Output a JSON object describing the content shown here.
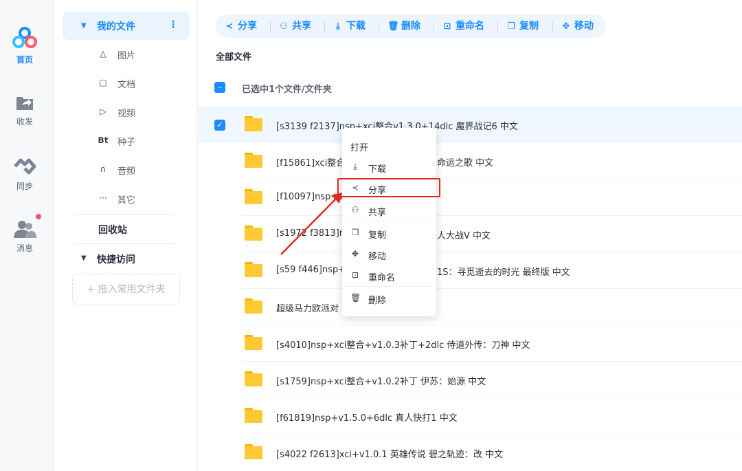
{
  "rail": {
    "items": [
      {
        "label": "首页",
        "icon": "cloud-logo-icon"
      },
      {
        "label": "收发",
        "icon": "folder-share-icon"
      },
      {
        "label": "同步",
        "icon": "sync-icon"
      },
      {
        "label": "消息",
        "icon": "users-icon"
      }
    ],
    "colors": {
      "active": "#1a8cff",
      "badge": "#ff4d6a"
    }
  },
  "nav": {
    "mine": "我的文件",
    "more": "⋮",
    "subs": [
      {
        "icon": "image-icon",
        "glyph": "△",
        "label": "图片"
      },
      {
        "icon": "doc-icon",
        "glyph": "▢",
        "label": "文档"
      },
      {
        "icon": "video-icon",
        "glyph": "▷",
        "label": "视频"
      },
      {
        "icon": "bt-icon",
        "glyph": "Bt",
        "label": "种子"
      },
      {
        "icon": "headphone-icon",
        "glyph": "∩",
        "label": "音频"
      },
      {
        "icon": "more-icon",
        "glyph": "···",
        "label": "其它"
      }
    ],
    "recycle": "回收站",
    "quick": "快捷访问",
    "quick_add": "+ 拖入常用文件夹"
  },
  "toolbar": [
    {
      "glyph": "≺",
      "label": "分享",
      "icon": "share-icon"
    },
    {
      "glyph": "⚇",
      "label": "共享",
      "icon": "co-share-icon"
    },
    {
      "glyph": "⤓",
      "label": "下载",
      "icon": "download-icon"
    },
    {
      "glyph": "🗑",
      "label": "删除",
      "icon": "trash-icon"
    },
    {
      "glyph": "⊡",
      "label": "重命名",
      "icon": "rename-icon"
    },
    {
      "glyph": "❐",
      "label": "复制",
      "icon": "copy-icon"
    },
    {
      "glyph": "✥",
      "label": "移动",
      "icon": "move-icon"
    }
  ],
  "crumb": "全部文件",
  "selection": "已选中1个文件/文件夹",
  "files": [
    "[s3139 f2137]nsp+xci整合v1.3.0+14dlc 魔界战记6 中文",
    "[f15861]xci整合v",
    "[f10097]nsp+v1.",
    "[s1972 f3813]ns",
    "[s59 f446]nsp+v",
    "超级马力欧派对",
    "[s4010]nsp+xci整合+v1.0.3补丁+2dlc 侍道外传：刀神 中文",
    "[s1759]nsp+xci整合+v1.0.2补丁 伊苏：始源 中文",
    "[f61819]nsp+v1.5.0+6dlc 真人快打1 中文",
    "[s4022 f2613]xci+v1.0.1 英雄传说 碧之轨迹：改 中文"
  ],
  "file_tails": [
    "",
    "命运之歌 中文",
    "",
    "人大战V 中文",
    "1S：寻觅逝去的时光 最终版 中文",
    "",
    "",
    "",
    "",
    ""
  ],
  "context_menu": [
    {
      "label": "打开",
      "icon": "",
      "glyph": ""
    },
    {
      "label": "下载",
      "icon": "download-icon",
      "glyph": "⤓"
    },
    {
      "label": "分享",
      "icon": "share-icon",
      "glyph": "≺"
    },
    {
      "label": "共享",
      "icon": "co-share-icon",
      "glyph": "⚇"
    },
    {
      "label": "复制",
      "icon": "copy-icon",
      "glyph": "❐"
    },
    {
      "label": "移动",
      "icon": "move-icon",
      "glyph": "✥"
    },
    {
      "label": "重命名",
      "icon": "rename-icon",
      "glyph": "⊡"
    },
    {
      "label": "删除",
      "icon": "trash-icon",
      "glyph": "🗑"
    }
  ],
  "checkmark": "✓",
  "minus": "–",
  "annotation_color": "#e8281e"
}
